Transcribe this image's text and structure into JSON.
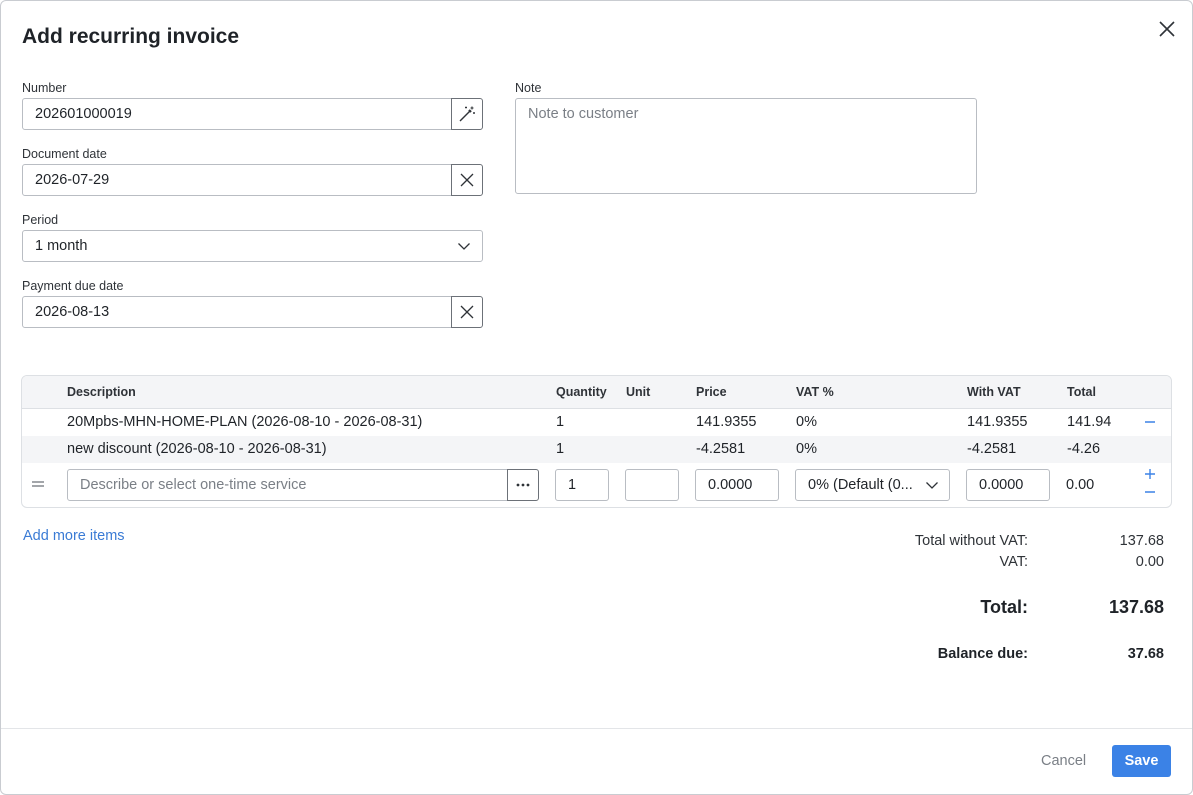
{
  "dialog": {
    "title": "Add recurring invoice"
  },
  "form": {
    "number_label": "Number",
    "number_value": "202601000019",
    "document_date_label": "Document date",
    "document_date_value": "2026-07-29",
    "period_label": "Period",
    "period_value": "1 month",
    "payment_due_label": "Payment due date",
    "payment_due_value": "2026-08-13",
    "note_label": "Note",
    "note_placeholder": "Note to customer"
  },
  "table": {
    "headers": {
      "description": "Description",
      "quantity": "Quantity",
      "unit": "Unit",
      "price": "Price",
      "vat": "VAT %",
      "with_vat": "With VAT",
      "total": "Total"
    },
    "rows": [
      {
        "description": "20Mpbs-MHN-HOME-PLAN (2026-08-10 - 2026-08-31)",
        "quantity": "1",
        "unit": "",
        "price": "141.9355",
        "vat": "0%",
        "with_vat": "141.9355",
        "total": "141.94"
      },
      {
        "description": "new discount (2026-08-10 - 2026-08-31)",
        "quantity": "1",
        "unit": "",
        "price": "-4.2581",
        "vat": "0%",
        "with_vat": "-4.2581",
        "total": "-4.26"
      }
    ],
    "new_row": {
      "description_placeholder": "Describe or select one-time service",
      "quantity": "1",
      "unit": "",
      "price": "0.0000",
      "vat": "0% (Default (0...",
      "with_vat": "0.0000",
      "total": "0.00"
    }
  },
  "add_more_label": "Add more items",
  "summary": {
    "total_without_vat_label": "Total without VAT:",
    "total_without_vat_value": "137.68",
    "vat_label": "VAT:",
    "vat_value": "0.00",
    "total_label": "Total:",
    "total_value": "137.68",
    "balance_due_label": "Balance due:",
    "balance_due_value": "37.68"
  },
  "footer": {
    "cancel_label": "Cancel",
    "save_label": "Save"
  },
  "icons": [
    "close-icon",
    "magic-wand-icon",
    "clear-icon",
    "chevron-down-icon",
    "drag-handle-icon",
    "more-icon",
    "minus-icon",
    "plus-icon"
  ],
  "colors": {
    "accent": "#3b82e6",
    "link": "#3a7bd5",
    "border": "#b9bdc3",
    "header_bg": "#f4f5f7"
  }
}
